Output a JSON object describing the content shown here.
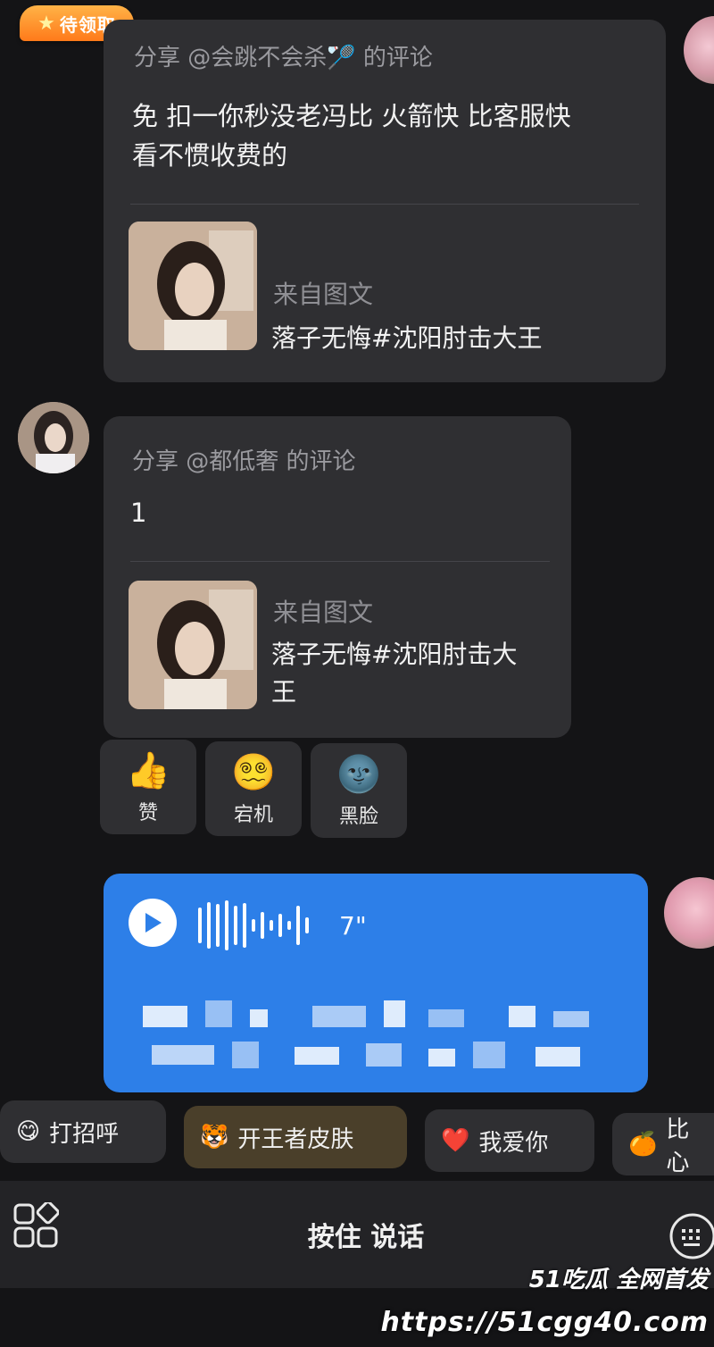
{
  "badge": {
    "label": "待领取"
  },
  "messages": [
    {
      "share_title": "分享 @会跳不会杀🏸 的评论",
      "comment": [
        "免  扣一你秒没老冯比 火箭快 比客服快",
        "看不惯收费的"
      ],
      "source_label": "来自图文",
      "source_title": [
        "落子无悔#沈阳肘击大王"
      ]
    },
    {
      "share_title": "分享 @都低奢 的评论",
      "comment": [
        "1"
      ],
      "source_label": "来自图文",
      "source_title": [
        "落子无悔#沈阳肘击大",
        "王"
      ]
    }
  ],
  "reactions": [
    {
      "icon": "thumbs-up-icon",
      "emoji": "👍",
      "label": "赞"
    },
    {
      "icon": "dizzy-face-icon",
      "emoji": "😵‍💫",
      "label": "宕机"
    },
    {
      "icon": "dark-moon-face-icon",
      "emoji": "🌚",
      "label": "黑脸"
    }
  ],
  "voice_message": {
    "duration": "7\""
  },
  "quick_replies": [
    {
      "emoji": "😋",
      "label": "打招呼"
    },
    {
      "emoji": "🐯",
      "label": "开王者皮肤"
    },
    {
      "emoji": "❤️",
      "label": "我爱你"
    },
    {
      "emoji": "🍊",
      "label": "比心"
    }
  ],
  "input_bar": {
    "hold_to_talk": "按住 说话"
  },
  "watermark": {
    "line1": "51吃瓜 全网首发",
    "line2": "https://51cgg40.com"
  },
  "colors": {
    "bubble": "#2f2f32",
    "voice_bubble": "#2d7fe8",
    "background": "#141416",
    "badge": "#ff8a1f"
  }
}
